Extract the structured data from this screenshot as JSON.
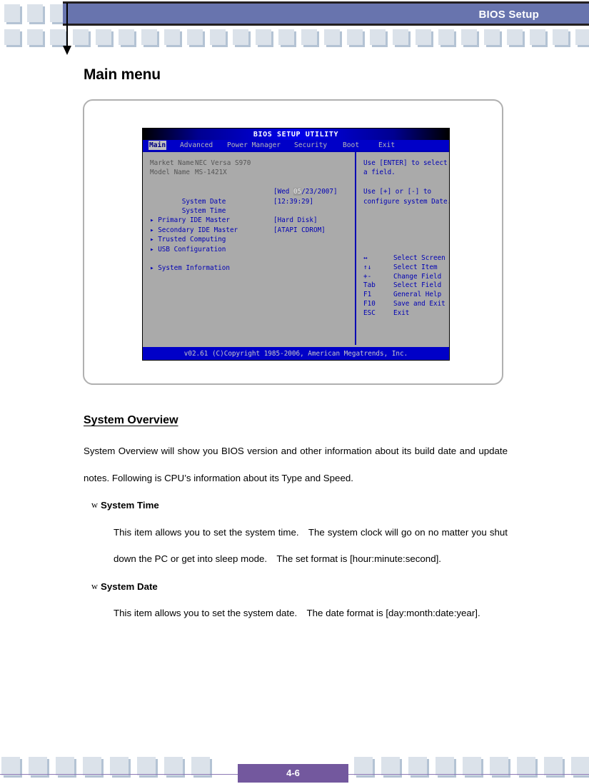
{
  "header": {
    "title": "BIOS Setup"
  },
  "page_title": "Main menu",
  "bios": {
    "utility_title": "BIOS SETUP UTILITY",
    "menu_tabs": [
      {
        "label": "Main",
        "selected": true
      },
      {
        "label": "Advanced",
        "selected": false
      },
      {
        "label": "Power Manager",
        "selected": false
      },
      {
        "label": "Security",
        "selected": false
      },
      {
        "label": "Boot",
        "selected": false
      },
      {
        "label": "Exit",
        "selected": false
      }
    ],
    "info_rows": [
      {
        "label": "Market Name",
        "value": "NEC Versa S970"
      },
      {
        "label": "Model Name",
        "value": "MS-1421X"
      }
    ],
    "date_label": "System Date",
    "date_prefix": "[Wed ",
    "date_selected": "05",
    "date_suffix": "/23/2007]",
    "time_label": "System Time",
    "time_value": "[12:39:29]",
    "menu_items": [
      {
        "label": "Primary IDE Master",
        "value": "[Hard Disk]"
      },
      {
        "label": "Secondary IDE Master",
        "value": "[ATAPI CDROM]"
      },
      {
        "label": "Trusted Computing",
        "value": ""
      },
      {
        "label": "USB Configuration",
        "value": ""
      }
    ],
    "menu_items2": [
      {
        "label": "System Information",
        "value": ""
      }
    ],
    "help_lines": [
      "Use [ENTER] to select",
      "a field.",
      "",
      "Use [+] or [-] to",
      "configure system Date."
    ],
    "key_legend": [
      {
        "key": "↔",
        "desc": "Select Screen"
      },
      {
        "key": "↑↓",
        "desc": "Select Item"
      },
      {
        "key": "+-",
        "desc": "Change Field"
      },
      {
        "key": "Tab",
        "desc": "Select Field"
      },
      {
        "key": "F1",
        "desc": "General Help"
      },
      {
        "key": "F10",
        "desc": "Save and Exit"
      },
      {
        "key": "ESC",
        "desc": "Exit"
      }
    ],
    "copyright": "v02.61 (C)Copyright 1985-2006, American Megatrends, Inc."
  },
  "content": {
    "section_heading": "System Overview",
    "intro": "System Overview will show you BIOS version and other information about its build date and update notes. Following is CPU’s information about its Type and Speed.",
    "bullet_glyph": "w",
    "items": [
      {
        "title": "System Time",
        "body": "This item allows you to set the system time. The system clock will go on no matter you shut down the PC or get into sleep mode. The set format is [hour:minute:second]."
      },
      {
        "title": "System Date",
        "body": "This item allows you to set the system date. The date format is [day:month:date:year]."
      }
    ]
  },
  "footer": {
    "page_number": "4-6"
  },
  "colors": {
    "header_bar": "#6874ae",
    "square": "#dbe2ea",
    "square_shadow": "#b4c3d4",
    "page_box": "#73589e",
    "bios_blue": "#0000c8",
    "bios_gray": "#aaaaaa"
  }
}
